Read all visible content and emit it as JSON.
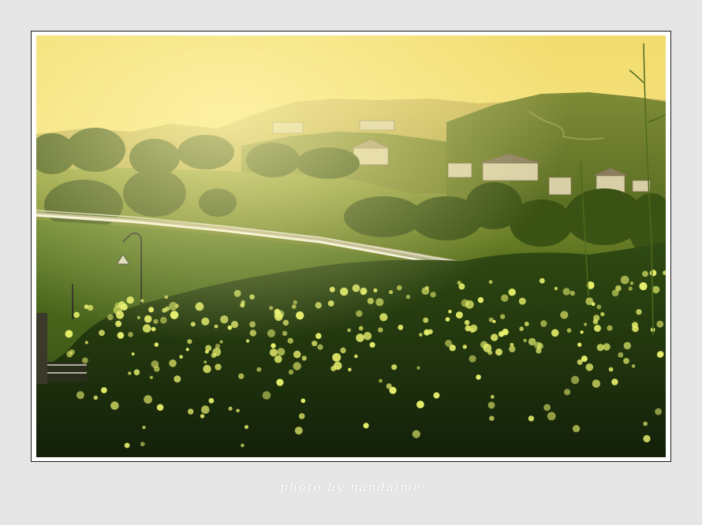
{
  "photo": {
    "subject": "landscape",
    "colors": {
      "sky": "#f7e58a",
      "haze": "#e8cf6a",
      "hill_far": "#b9a54a",
      "hill_near": "#6b7a2a",
      "field": "#5f7624",
      "foliage_dark": "#1f2c0c",
      "flowers": "#e7ef6c"
    }
  },
  "watermark": {
    "text": "photo by nandalme"
  }
}
